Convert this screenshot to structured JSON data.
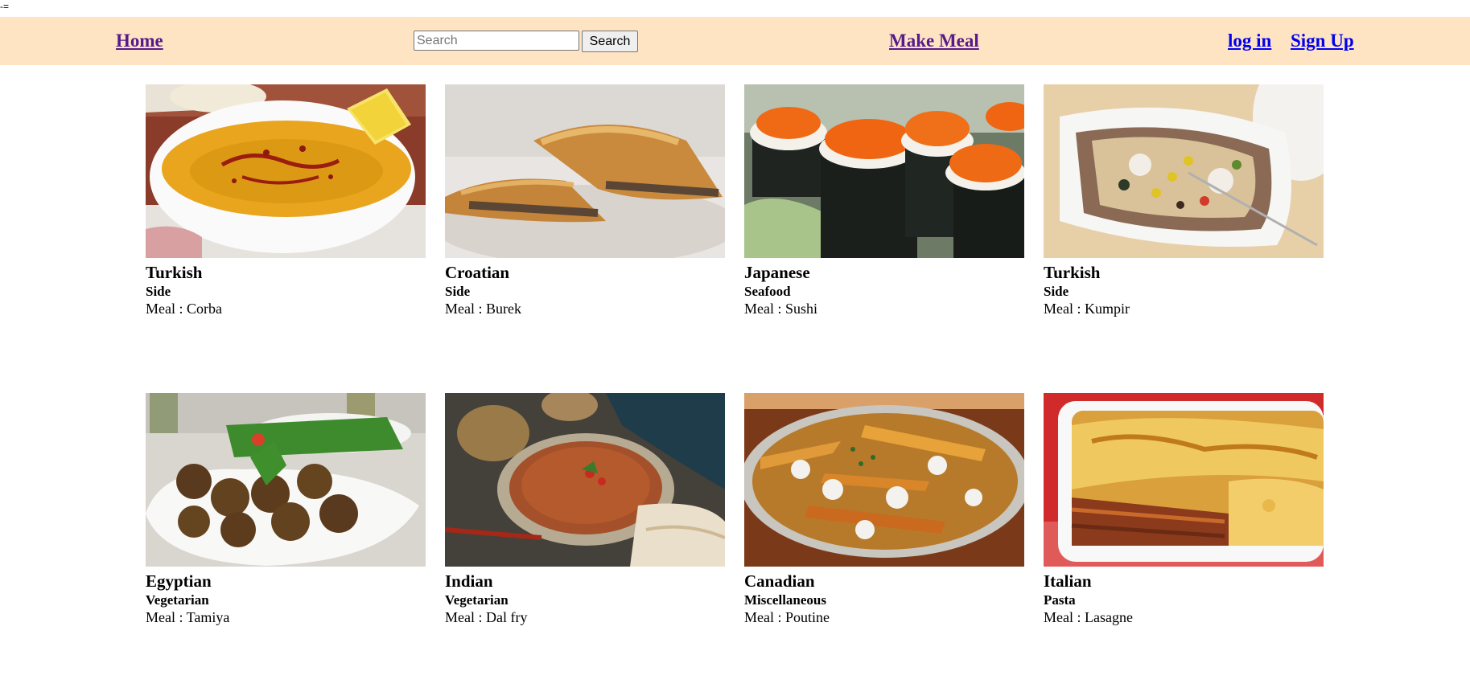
{
  "page_mark": "-=",
  "nav": {
    "home": "Home",
    "search_placeholder": "Search",
    "search_button": "Search",
    "make_meal": "Make Meal",
    "login": "log in",
    "signup": "Sign Up"
  },
  "meal_prefix": "Meal : ",
  "meals": [
    {
      "cuisine": "Turkish",
      "category": "Side",
      "meal": "Meal : Corba",
      "image": "lentil-soup-photo"
    },
    {
      "cuisine": "Croatian",
      "category": "Side",
      "meal": "Meal : Burek",
      "image": "burek-pastry-photo"
    },
    {
      "cuisine": "Japanese",
      "category": "Seafood",
      "meal": "Meal : Sushi",
      "image": "sushi-photo"
    },
    {
      "cuisine": "Turkish",
      "category": "Side",
      "meal": "Meal : Kumpir",
      "image": "kumpir-potato-photo"
    },
    {
      "cuisine": "Egyptian",
      "category": "Vegetarian",
      "meal": "Meal : Tamiya",
      "image": "falafel-photo"
    },
    {
      "cuisine": "Indian",
      "category": "Vegetarian",
      "meal": "Meal : Dal fry",
      "image": "dal-fry-photo"
    },
    {
      "cuisine": "Canadian",
      "category": "Miscellaneous",
      "meal": "Meal : Poutine",
      "image": "poutine-photo"
    },
    {
      "cuisine": "Italian",
      "category": "Pasta",
      "meal": "Meal : Lasagne",
      "image": "lasagne-photo"
    }
  ],
  "colors": {
    "navbar_bg": "#ffe4c4",
    "link_visited": "#551a8b",
    "link_unvisited": "#0000ee"
  }
}
